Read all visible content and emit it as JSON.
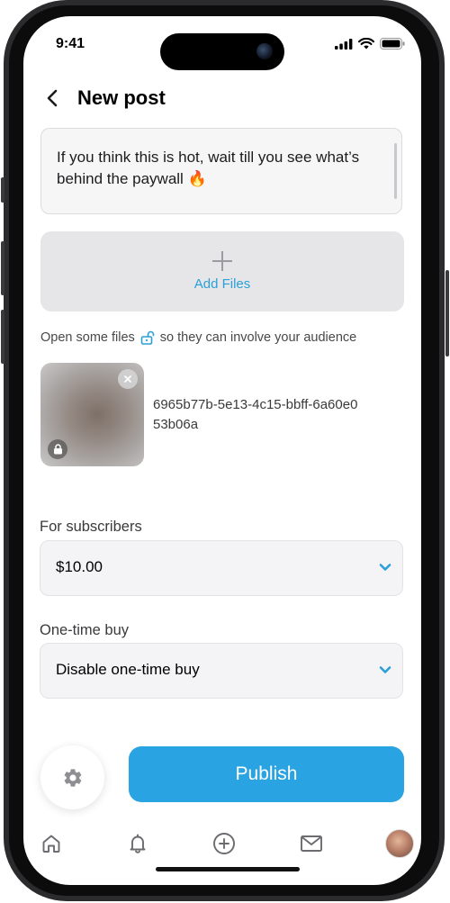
{
  "status_bar": {
    "time": "9:41"
  },
  "header": {
    "title": "New post"
  },
  "caption": {
    "text": "If you think this is hot, wait till you see what’s behind the paywall 🔥"
  },
  "upload": {
    "add_files_label": "Add Files"
  },
  "hint": {
    "before": "Open some files",
    "after": "so they can involve your audience"
  },
  "attachment": {
    "filename": "6965b77b-5e13-4c15-bbff-6a60e053b06a"
  },
  "subscribers": {
    "label": "For subscribers",
    "value": "$10.00"
  },
  "one_time": {
    "label": "One-time buy",
    "value": "Disable one-time buy"
  },
  "actions": {
    "publish_label": "Publish"
  },
  "colors": {
    "accent": "#2aa3e2",
    "link": "#2a9fd8"
  },
  "tabbar": {
    "icons": [
      "home-icon",
      "bell-icon",
      "add-circle-icon",
      "mail-icon",
      "avatar"
    ]
  }
}
